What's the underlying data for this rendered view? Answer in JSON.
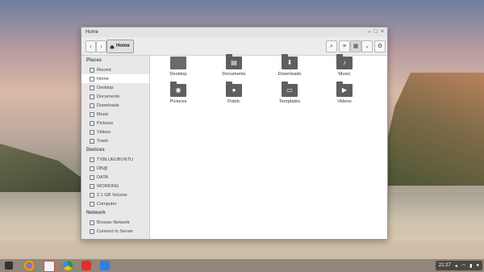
{
  "window": {
    "title": "Home",
    "controls": [
      "–",
      "□",
      "×"
    ]
  },
  "toolbar": {
    "back": "‹",
    "forward": "›",
    "path_label": "Home",
    "search": "⌕",
    "list_view": "≡",
    "grid_view": "▦",
    "dropdown": "⌄",
    "settings": "⚙"
  },
  "sidebar": {
    "places_title": "Places",
    "places": [
      {
        "label": "Recent",
        "icon": "clock-icon"
      },
      {
        "label": "Home",
        "icon": "home-icon",
        "selected": true
      },
      {
        "label": "Desktop",
        "icon": "desktop-icon"
      },
      {
        "label": "Documents",
        "icon": "document-icon"
      },
      {
        "label": "Downloads",
        "icon": "download-icon"
      },
      {
        "label": "Music",
        "icon": "music-icon"
      },
      {
        "label": "Pictures",
        "icon": "camera-icon"
      },
      {
        "label": "Videos",
        "icon": "video-icon"
      },
      {
        "label": "Trash",
        "icon": "trash-icon"
      }
    ],
    "devices_title": "Devices",
    "devices": [
      {
        "label": "TXBLUEUBUNTU",
        "icon": "drive-icon"
      },
      {
        "label": "DB@",
        "icon": "drive-icon"
      },
      {
        "label": "DATA",
        "icon": "drive-icon"
      },
      {
        "label": "WORKING",
        "icon": "drive-icon"
      },
      {
        "label": "2.1 GB Volume",
        "icon": "drive-icon"
      },
      {
        "label": "Computer",
        "icon": "computer-icon"
      }
    ],
    "network_title": "Network",
    "network": [
      {
        "label": "Browse Network",
        "icon": "network-icon"
      },
      {
        "label": "Connect to Server",
        "icon": "server-icon"
      }
    ]
  },
  "files": [
    {
      "label": "Desktop",
      "glyph": ""
    },
    {
      "label": "Documents",
      "glyph": "▤"
    },
    {
      "label": "Downloads",
      "glyph": "⬇"
    },
    {
      "label": "Music",
      "glyph": "♪"
    },
    {
      "label": "Pictures",
      "glyph": "◉"
    },
    {
      "label": "Public",
      "glyph": "●"
    },
    {
      "label": "Templates",
      "glyph": "▭"
    },
    {
      "label": "Videos",
      "glyph": "▶"
    }
  ],
  "shelf": {
    "time": "21:27",
    "apps": [
      "chrome-icon",
      "gmail-icon",
      "drive-icon",
      "youtube-icon",
      "files-icon"
    ]
  }
}
